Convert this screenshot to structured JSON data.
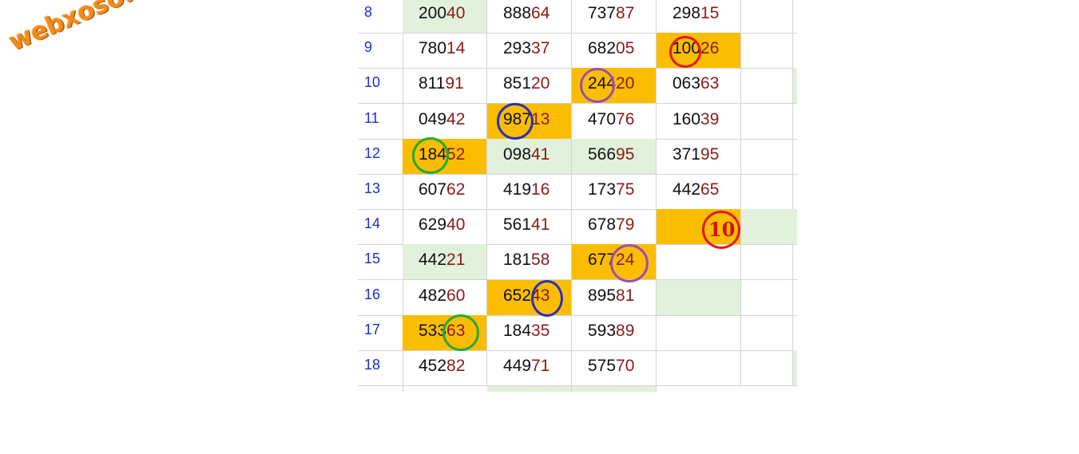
{
  "logo": {
    "text": "webxoso.net"
  },
  "rows": [
    {
      "index": "8",
      "cells": [
        {
          "head": "200",
          "tail": "40",
          "bg": "green"
        },
        {
          "head": "888",
          "tail": "64",
          "bg": ""
        },
        {
          "head": "737",
          "tail": "87",
          "bg": ""
        },
        {
          "head": "298",
          "tail": "15",
          "bg": ""
        }
      ]
    },
    {
      "index": "9",
      "cells": [
        {
          "head": "780",
          "tail": "14",
          "bg": ""
        },
        {
          "head": "293",
          "tail": "37",
          "bg": ""
        },
        {
          "head": "682",
          "tail": "05",
          "bg": ""
        },
        {
          "head": "100",
          "tail": "26",
          "bg": "orange"
        }
      ]
    },
    {
      "index": "10",
      "cells": [
        {
          "head": "811",
          "tail": "91",
          "bg": ""
        },
        {
          "head": "851",
          "tail": "20",
          "bg": ""
        },
        {
          "head": "244",
          "tail": "20",
          "bg": "orange"
        },
        {
          "head": "063",
          "tail": "63",
          "bg": ""
        }
      ]
    },
    {
      "index": "11",
      "cells": [
        {
          "head": "049",
          "tail": "42",
          "bg": ""
        },
        {
          "head": "987",
          "tail": "13",
          "bg": "orange"
        },
        {
          "head": "470",
          "tail": "76",
          "bg": ""
        },
        {
          "head": "160",
          "tail": "39",
          "bg": ""
        }
      ]
    },
    {
      "index": "12",
      "cells": [
        {
          "head": "184",
          "tail": "52",
          "bg": "orange"
        },
        {
          "head": "098",
          "tail": "41",
          "bg": "green"
        },
        {
          "head": "566",
          "tail": "95",
          "bg": "green"
        },
        {
          "head": "371",
          "tail": "95",
          "bg": ""
        }
      ]
    },
    {
      "index": "13",
      "cells": [
        {
          "head": "607",
          "tail": "62",
          "bg": ""
        },
        {
          "head": "419",
          "tail": "16",
          "bg": ""
        },
        {
          "head": "173",
          "tail": "75",
          "bg": ""
        },
        {
          "head": "442",
          "tail": "65",
          "bg": ""
        }
      ]
    },
    {
      "index": "14",
      "cells": [
        {
          "head": "629",
          "tail": "40",
          "bg": ""
        },
        {
          "head": "561",
          "tail": "41",
          "bg": ""
        },
        {
          "head": "678",
          "tail": "79",
          "bg": ""
        },
        {
          "head": "",
          "tail": "",
          "bg": "orange"
        }
      ]
    },
    {
      "index": "15",
      "cells": [
        {
          "head": "442",
          "tail": "21",
          "bg": "green"
        },
        {
          "head": "181",
          "tail": "58",
          "bg": ""
        },
        {
          "head": "677",
          "tail": "24",
          "bg": "orange"
        },
        {
          "head": "",
          "tail": "",
          "bg": ""
        }
      ]
    },
    {
      "index": "16",
      "cells": [
        {
          "head": "482",
          "tail": "60",
          "bg": ""
        },
        {
          "head": "652",
          "tail": "43",
          "bg": "orange"
        },
        {
          "head": "895",
          "tail": "81",
          "bg": ""
        },
        {
          "head": "",
          "tail": "",
          "bg": "green"
        }
      ]
    },
    {
      "index": "17",
      "cells": [
        {
          "head": "533",
          "tail": "63",
          "bg": "orange"
        },
        {
          "head": "184",
          "tail": "35",
          "bg": ""
        },
        {
          "head": "593",
          "tail": "89",
          "bg": ""
        },
        {
          "head": "",
          "tail": "",
          "bg": ""
        }
      ]
    },
    {
      "index": "18",
      "cells": [
        {
          "head": "452",
          "tail": "82",
          "bg": ""
        },
        {
          "head": "449",
          "tail": "71",
          "bg": ""
        },
        {
          "head": "575",
          "tail": "70",
          "bg": ""
        },
        {
          "head": "",
          "tail": "",
          "bg": ""
        }
      ]
    }
  ],
  "annotation": {
    "label": "10"
  },
  "colors": {
    "orange": "#fbbd00",
    "green": "#e1f1dc",
    "index": "#1a2fd0",
    "tail": "#8b1a1a",
    "red_circle": "#e01b24",
    "purple_circle": "#9b4fb0",
    "blue_circle": "#2b2fc0",
    "green_circle": "#27a83a"
  }
}
